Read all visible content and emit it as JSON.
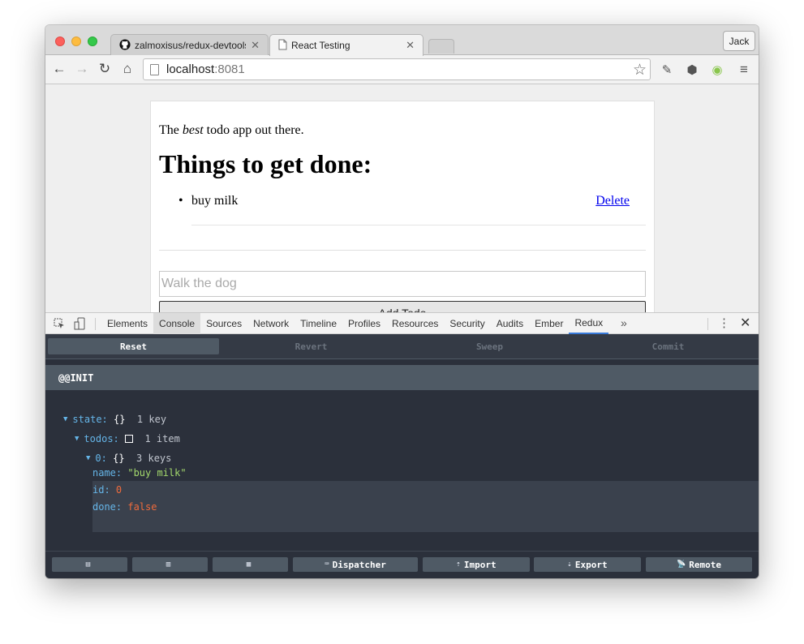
{
  "browser": {
    "tabs": [
      {
        "title": "zalmoxisus/redux-devtools",
        "icon": "github-icon"
      },
      {
        "title": "React Testing",
        "icon": "page-icon"
      }
    ],
    "profile": "Jack",
    "url": {
      "host": "localhost",
      "port": ":8081"
    }
  },
  "page": {
    "intro_before": "The ",
    "intro_em": "best",
    "intro_after": " todo app out there.",
    "heading": "Things to get done:",
    "todos": [
      {
        "name": "buy milk",
        "delete": "Delete"
      }
    ],
    "input_placeholder": "Walk the dog",
    "add_label": "Add Todo"
  },
  "devtools": {
    "tabs": [
      "Elements",
      "Console",
      "Sources",
      "Network",
      "Timeline",
      "Profiles",
      "Resources",
      "Security",
      "Audits",
      "Ember",
      "Redux"
    ],
    "selected": "Console",
    "active": "Redux"
  },
  "redux": {
    "controls": [
      "Reset",
      "Revert",
      "Sweep",
      "Commit"
    ],
    "action": "@@INIT",
    "tree": {
      "state_key": "state:",
      "state_type": "{}",
      "state_count": "1 key",
      "todos_key": "todos:",
      "todos_count": "1 item",
      "item_key": "0:",
      "item_type": "{}",
      "item_count": "3 keys",
      "name_key": "name:",
      "name_val": "\"buy milk\"",
      "id_key": "id:",
      "id_val": "0",
      "done_key": "done:",
      "done_val": "false"
    },
    "footer": [
      "Dispatcher",
      "Import",
      "Export",
      "Remote"
    ],
    "colors": {
      "bg": "#2b303b",
      "header": "#4f5a65",
      "key": "#65b5e8",
      "string": "#a3d86c",
      "number": "#ef6b3c"
    }
  }
}
